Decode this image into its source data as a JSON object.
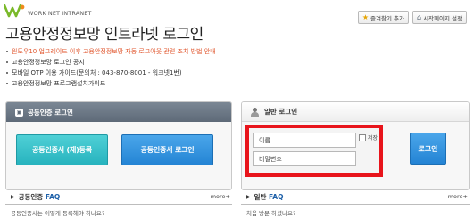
{
  "header": {
    "logo_text": "WORK NET INTRANET",
    "title": "고용안정정보망 인트라넷 로그인",
    "bookmark_label": "즐겨찾기 추가",
    "homepage_label": "시작페이지 설정"
  },
  "notices": [
    "윈도우10 업그레이드 이후 고용안정정보망 자동 로그아웃 관련 조치 방법 안내",
    "고용안정정보망 로그인 공지",
    "모바일 OTP 이용 가이드(문의처 : 043-870-8001 - 워크넷1번)",
    "고용안정정보망 프로그램설치가이드"
  ],
  "cert_panel": {
    "title": "공동인증 로그인",
    "register_label": "공동인증서 (재)등록",
    "login_label": "공동인증서 로그인"
  },
  "general_panel": {
    "title": "일반 로그인",
    "name_placeholder": "이름",
    "password_placeholder": "비밀번호",
    "save_label": "저장",
    "login_label": "로그인"
  },
  "faq_cert": {
    "title_prefix": "공동인증",
    "title_suffix": " FAQ",
    "more": "more+",
    "first_item": "공동인증서는 어떻게 등록해야 하나요?"
  },
  "faq_general": {
    "title_prefix": "일반",
    "title_suffix": " FAQ",
    "more": "more+",
    "first_item": "처음 방문 하셨나요?"
  },
  "colors": {
    "highlight_notice": "#e0552c",
    "register_button": "#27b3be",
    "login_button": "#2484d4",
    "highlight_border": "#e8141b",
    "logo_green": "#7ab929",
    "logo_orange": "#f08a1c"
  }
}
